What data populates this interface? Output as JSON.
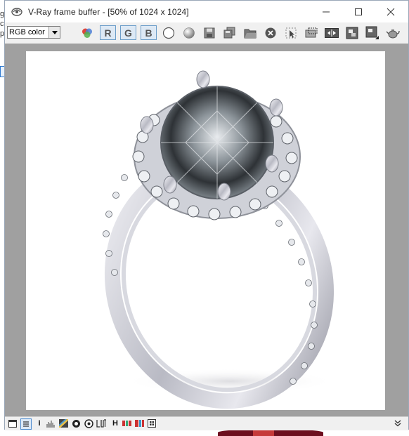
{
  "window": {
    "title": "V-Ray frame buffer - [50% of 1024 x 1024]"
  },
  "toolbar": {
    "color_mode": "RGB color",
    "channel_r": "R",
    "channel_g": "G",
    "channel_b": "B"
  },
  "statusbar": {
    "info_glyph": "i",
    "h_glyph": "H"
  },
  "background": {
    "left_strip_chars": [
      "g",
      "c",
      "p"
    ]
  },
  "colors": {
    "channel_border": "#6c9ec9",
    "viewport_bg": "#a0a0a0",
    "render_bg": "#ffffff"
  }
}
